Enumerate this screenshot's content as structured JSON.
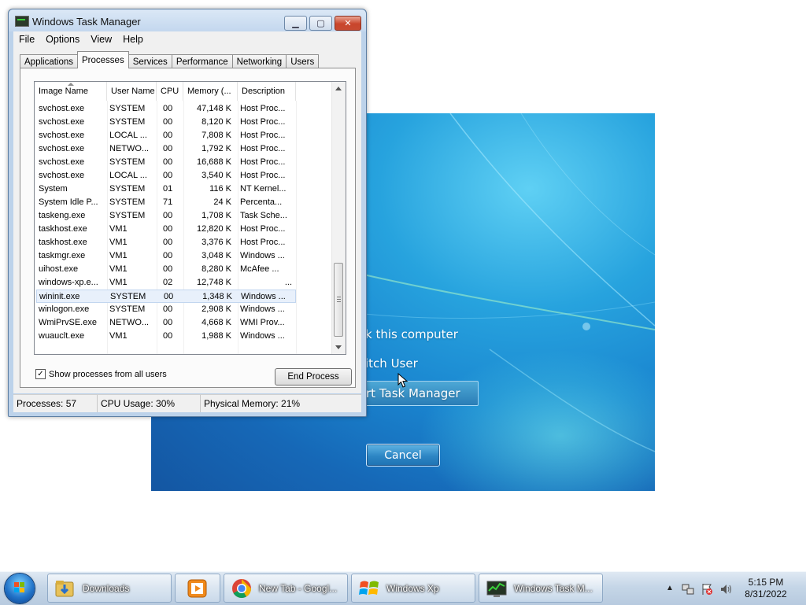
{
  "window": {
    "title": "Windows Task Manager",
    "caption_buttons": [
      "minimize-icon",
      "maximize-icon",
      "close-icon"
    ]
  },
  "menu": [
    "File",
    "Options",
    "View",
    "Help"
  ],
  "tabs": [
    {
      "label": "Applications",
      "active": false
    },
    {
      "label": "Processes",
      "active": true
    },
    {
      "label": "Services",
      "active": false
    },
    {
      "label": "Performance",
      "active": false
    },
    {
      "label": "Networking",
      "active": false
    },
    {
      "label": "Users",
      "active": false
    }
  ],
  "process_table": {
    "columns": [
      "Image Name",
      "User Name",
      "CPU",
      "Memory (...",
      "Description"
    ],
    "sorted_by": "Image Name",
    "rows": [
      {
        "image": "svchost.exe",
        "user": "SYSTEM",
        "cpu": "00",
        "memory": "47,148 K",
        "description": "Host Proc..."
      },
      {
        "image": "svchost.exe",
        "user": "SYSTEM",
        "cpu": "00",
        "memory": "8,120 K",
        "description": "Host Proc..."
      },
      {
        "image": "svchost.exe",
        "user": "LOCAL ...",
        "cpu": "00",
        "memory": "7,808 K",
        "description": "Host Proc..."
      },
      {
        "image": "svchost.exe",
        "user": "NETWO...",
        "cpu": "00",
        "memory": "1,792 K",
        "description": "Host Proc..."
      },
      {
        "image": "svchost.exe",
        "user": "SYSTEM",
        "cpu": "00",
        "memory": "16,688 K",
        "description": "Host Proc..."
      },
      {
        "image": "svchost.exe",
        "user": "LOCAL ...",
        "cpu": "00",
        "memory": "3,540 K",
        "description": "Host Proc..."
      },
      {
        "image": "System",
        "user": "SYSTEM",
        "cpu": "01",
        "memory": "116 K",
        "description": "NT Kernel..."
      },
      {
        "image": "System Idle P...",
        "user": "SYSTEM",
        "cpu": "71",
        "memory": "24 K",
        "description": "Percenta..."
      },
      {
        "image": "taskeng.exe",
        "user": "SYSTEM",
        "cpu": "00",
        "memory": "1,708 K",
        "description": "Task Sche..."
      },
      {
        "image": "taskhost.exe",
        "user": "VM1",
        "cpu": "00",
        "memory": "12,820 K",
        "description": "Host Proc..."
      },
      {
        "image": "taskhost.exe",
        "user": "VM1",
        "cpu": "00",
        "memory": "3,376 K",
        "description": "Host Proc..."
      },
      {
        "image": "taskmgr.exe",
        "user": "VM1",
        "cpu": "00",
        "memory": "3,048 K",
        "description": "Windows ..."
      },
      {
        "image": "uihost.exe",
        "user": "VM1",
        "cpu": "00",
        "memory": "8,280 K",
        "description": "McAfee ..."
      },
      {
        "image": "windows-xp.e...",
        "user": "VM1",
        "cpu": "02",
        "memory": "12,748 K",
        "description": "..."
      },
      {
        "image": "wininit.exe",
        "user": "SYSTEM",
        "cpu": "00",
        "memory": "1,348 K",
        "description": "Windows ...",
        "selected": true
      },
      {
        "image": "winlogon.exe",
        "user": "SYSTEM",
        "cpu": "00",
        "memory": "2,908 K",
        "description": "Windows ..."
      },
      {
        "image": "WmiPrvSE.exe",
        "user": "NETWO...",
        "cpu": "00",
        "memory": "4,668 K",
        "description": "WMI Prov..."
      },
      {
        "image": "wuauclt.exe",
        "user": "VM1",
        "cpu": "00",
        "memory": "1,988 K",
        "description": "Windows ..."
      }
    ]
  },
  "show_all_processes": {
    "label": "Show processes from all users",
    "checked": true
  },
  "end_process_label": "End Process",
  "status": {
    "processes": "Processes: 57",
    "cpu": "CPU Usage: 30%",
    "memory": "Physical Memory: 21%"
  },
  "secure_screen": {
    "options": [
      {
        "label": "k this computer",
        "highlighted": false
      },
      {
        "label": "itch User",
        "highlighted": false
      },
      {
        "label": "rt Task Manager",
        "highlighted": true
      }
    ],
    "cancel_label": "Cancel"
  },
  "taskbar": {
    "buttons": [
      {
        "label": "Downloads",
        "icon": "folder-icon"
      },
      {
        "label": "",
        "icon": "media-player-icon"
      },
      {
        "label": "New Tab - Googl...",
        "icon": "chrome-icon"
      },
      {
        "label": "Windows Xp",
        "icon": "windows-xp-icon"
      },
      {
        "label": "Windows Task M...",
        "icon": "task-manager-icon",
        "active": true
      }
    ],
    "clock_time": "5:15 PM",
    "clock_date": "8/31/2022"
  },
  "colors": {
    "secure_bg": "#1a86d0",
    "selection": "#e8f0fb",
    "close_button": "#c9462c"
  }
}
